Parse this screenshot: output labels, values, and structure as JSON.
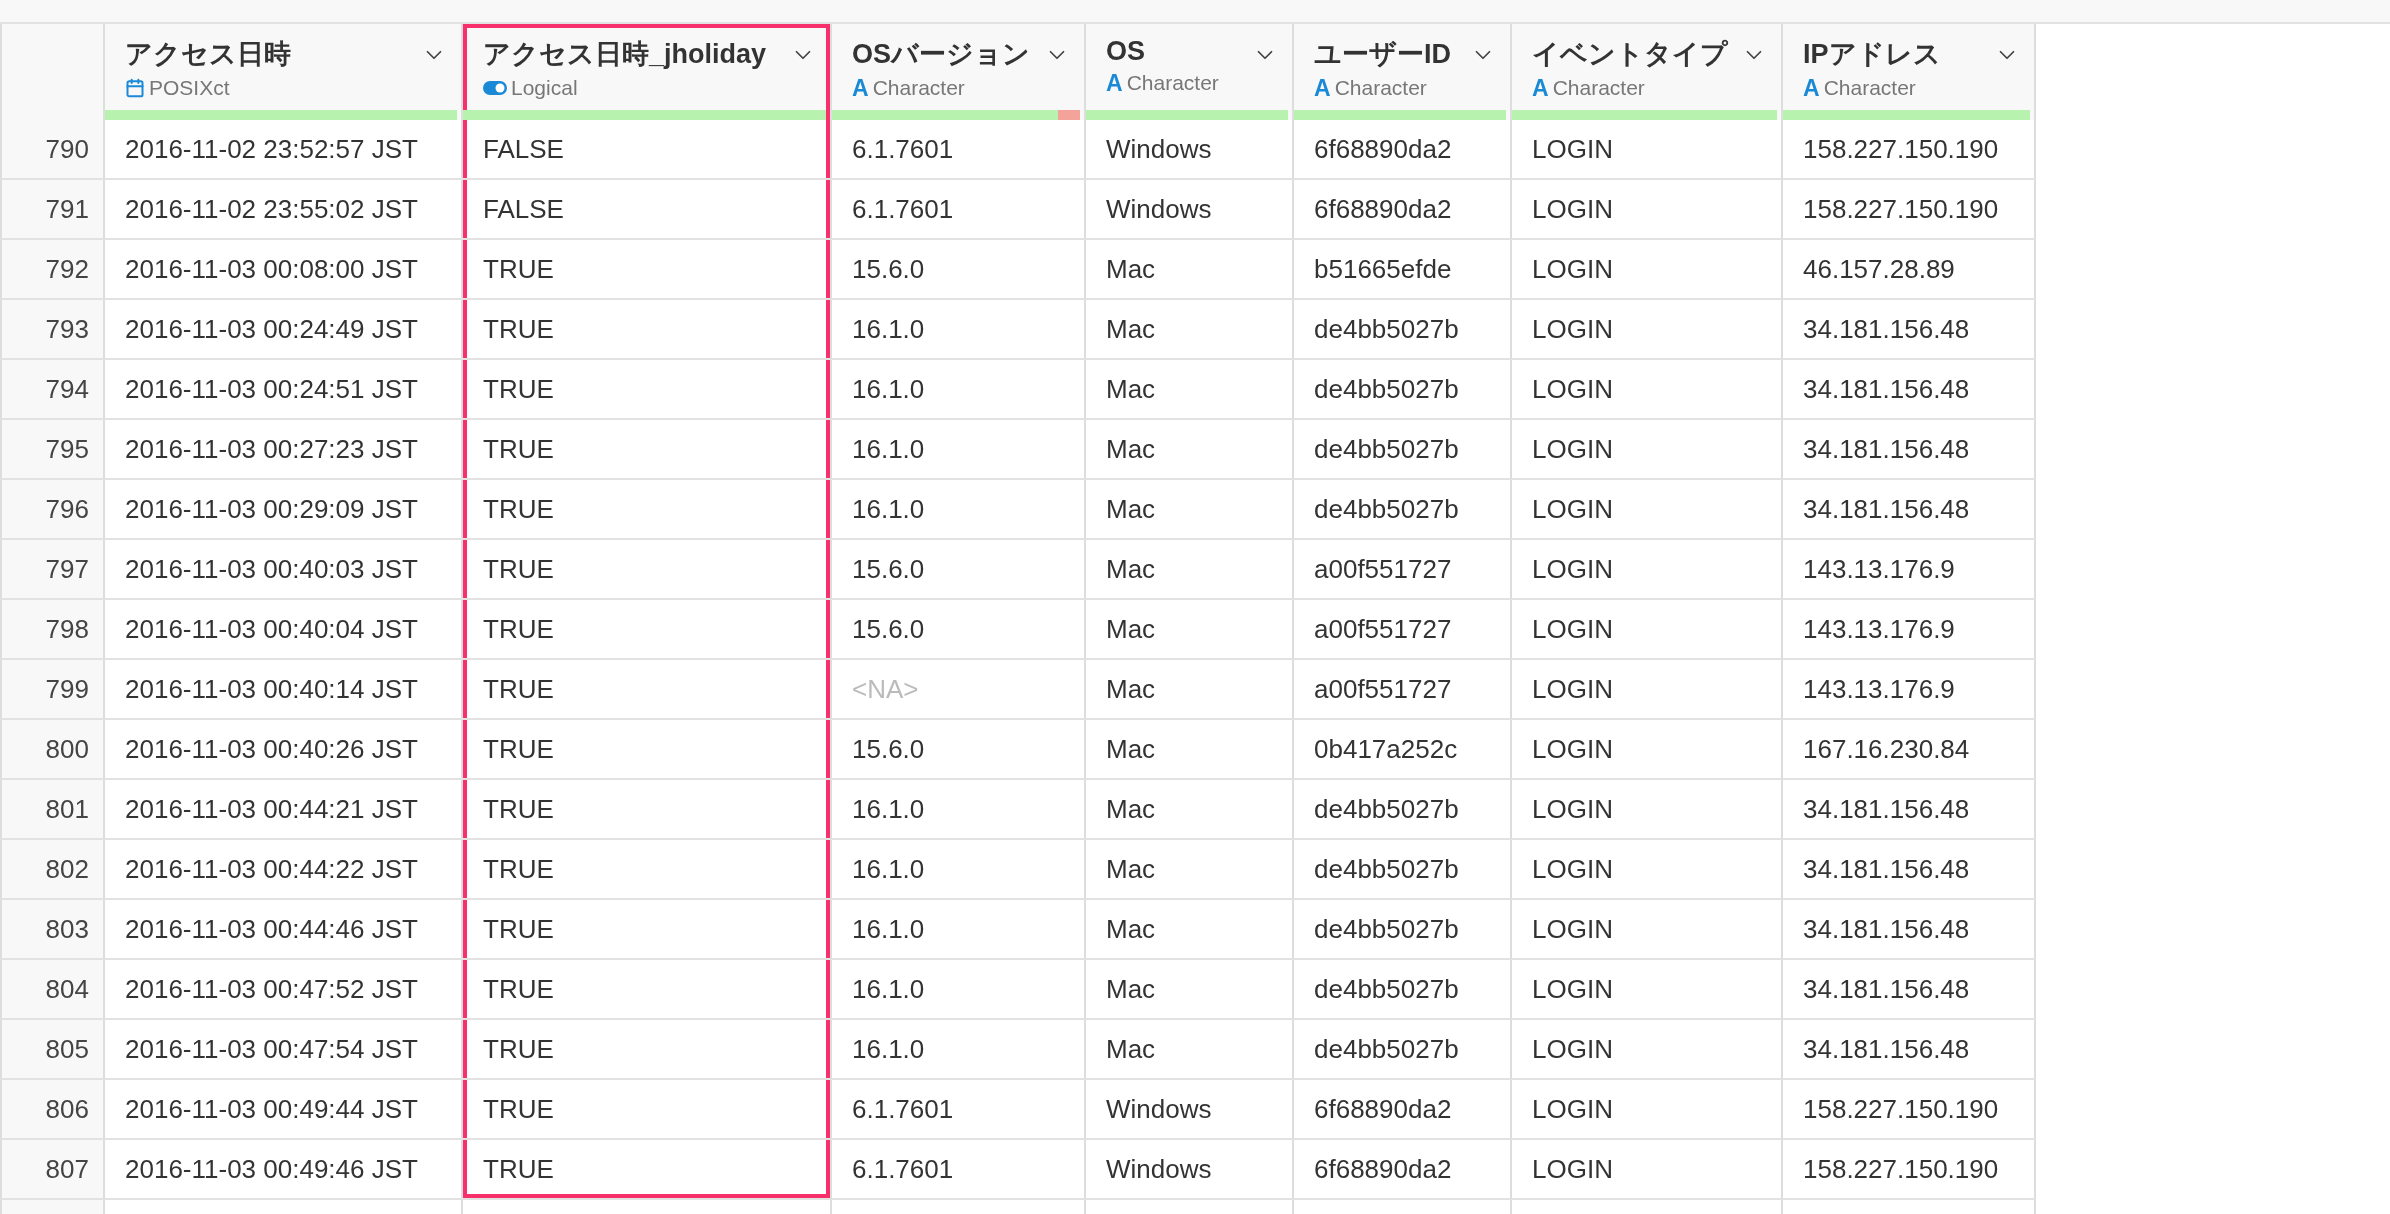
{
  "columns": [
    {
      "title": "アクセス日時",
      "type": {
        "kind": "date",
        "label": "POSIXct"
      },
      "quality": {
        "level": 1
      },
      "highlighted": false
    },
    {
      "title": "アクセス日時_jholiday",
      "type": {
        "kind": "logical",
        "label": "Logical"
      },
      "quality": {
        "level": 1
      },
      "highlighted": true
    },
    {
      "title": "OSバージョン",
      "type": {
        "kind": "character",
        "glyph": "A",
        "label": "Character"
      },
      "quality": {
        "level": 0.91
      },
      "highlighted": false
    },
    {
      "title": "OS",
      "type": {
        "kind": "character",
        "glyph": "A",
        "label": "Character"
      },
      "quality": {
        "level": 1
      },
      "highlighted": false
    },
    {
      "title": "ユーザーID",
      "type": {
        "kind": "character",
        "glyph": "A",
        "label": "Character"
      },
      "quality": {
        "level": 1
      },
      "highlighted": false
    },
    {
      "title": "イベントタイプ",
      "type": {
        "kind": "character",
        "glyph": "A",
        "label": "Character"
      },
      "quality": {
        "level": 1
      },
      "highlighted": false
    },
    {
      "title": "IPアドレス",
      "type": {
        "kind": "character",
        "glyph": "A",
        "label": "Character"
      },
      "quality": {
        "level": 1
      },
      "highlighted": false
    }
  ],
  "rows": [
    {
      "number": "790",
      "cells": [
        "2016-11-02 23:52:57 JST",
        "FALSE",
        "6.1.7601",
        "Windows",
        "6f68890da2",
        "LOGIN",
        "158.227.150.190"
      ],
      "missing": [
        false,
        false,
        false,
        false,
        false,
        false,
        false
      ]
    },
    {
      "number": "791",
      "cells": [
        "2016-11-02 23:55:02 JST",
        "FALSE",
        "6.1.7601",
        "Windows",
        "6f68890da2",
        "LOGIN",
        "158.227.150.190"
      ],
      "missing": [
        false,
        false,
        false,
        false,
        false,
        false,
        false
      ]
    },
    {
      "number": "792",
      "cells": [
        "2016-11-03 00:08:00 JST",
        "TRUE",
        "15.6.0",
        "Mac",
        "b51665efde",
        "LOGIN",
        "46.157.28.89"
      ],
      "missing": [
        false,
        false,
        false,
        false,
        false,
        false,
        false
      ]
    },
    {
      "number": "793",
      "cells": [
        "2016-11-03 00:24:49 JST",
        "TRUE",
        "16.1.0",
        "Mac",
        "de4bb5027b",
        "LOGIN",
        "34.181.156.48"
      ],
      "missing": [
        false,
        false,
        false,
        false,
        false,
        false,
        false
      ]
    },
    {
      "number": "794",
      "cells": [
        "2016-11-03 00:24:51 JST",
        "TRUE",
        "16.1.0",
        "Mac",
        "de4bb5027b",
        "LOGIN",
        "34.181.156.48"
      ],
      "missing": [
        false,
        false,
        false,
        false,
        false,
        false,
        false
      ]
    },
    {
      "number": "795",
      "cells": [
        "2016-11-03 00:27:23 JST",
        "TRUE",
        "16.1.0",
        "Mac",
        "de4bb5027b",
        "LOGIN",
        "34.181.156.48"
      ],
      "missing": [
        false,
        false,
        false,
        false,
        false,
        false,
        false
      ]
    },
    {
      "number": "796",
      "cells": [
        "2016-11-03 00:29:09 JST",
        "TRUE",
        "16.1.0",
        "Mac",
        "de4bb5027b",
        "LOGIN",
        "34.181.156.48"
      ],
      "missing": [
        false,
        false,
        false,
        false,
        false,
        false,
        false
      ]
    },
    {
      "number": "797",
      "cells": [
        "2016-11-03 00:40:03 JST",
        "TRUE",
        "15.6.0",
        "Mac",
        "a00f551727",
        "LOGIN",
        "143.13.176.9"
      ],
      "missing": [
        false,
        false,
        false,
        false,
        false,
        false,
        false
      ]
    },
    {
      "number": "798",
      "cells": [
        "2016-11-03 00:40:04 JST",
        "TRUE",
        "15.6.0",
        "Mac",
        "a00f551727",
        "LOGIN",
        "143.13.176.9"
      ],
      "missing": [
        false,
        false,
        false,
        false,
        false,
        false,
        false
      ]
    },
    {
      "number": "799",
      "cells": [
        "2016-11-03 00:40:14 JST",
        "TRUE",
        "<NA>",
        "Mac",
        "a00f551727",
        "LOGIN",
        "143.13.176.9"
      ],
      "missing": [
        false,
        false,
        true,
        false,
        false,
        false,
        false
      ]
    },
    {
      "number": "800",
      "cells": [
        "2016-11-03 00:40:26 JST",
        "TRUE",
        "15.6.0",
        "Mac",
        "0b417a252c",
        "LOGIN",
        "167.16.230.84"
      ],
      "missing": [
        false,
        false,
        false,
        false,
        false,
        false,
        false
      ]
    },
    {
      "number": "801",
      "cells": [
        "2016-11-03 00:44:21 JST",
        "TRUE",
        "16.1.0",
        "Mac",
        "de4bb5027b",
        "LOGIN",
        "34.181.156.48"
      ],
      "missing": [
        false,
        false,
        false,
        false,
        false,
        false,
        false
      ]
    },
    {
      "number": "802",
      "cells": [
        "2016-11-03 00:44:22 JST",
        "TRUE",
        "16.1.0",
        "Mac",
        "de4bb5027b",
        "LOGIN",
        "34.181.156.48"
      ],
      "missing": [
        false,
        false,
        false,
        false,
        false,
        false,
        false
      ]
    },
    {
      "number": "803",
      "cells": [
        "2016-11-03 00:44:46 JST",
        "TRUE",
        "16.1.0",
        "Mac",
        "de4bb5027b",
        "LOGIN",
        "34.181.156.48"
      ],
      "missing": [
        false,
        false,
        false,
        false,
        false,
        false,
        false
      ]
    },
    {
      "number": "804",
      "cells": [
        "2016-11-03 00:47:52 JST",
        "TRUE",
        "16.1.0",
        "Mac",
        "de4bb5027b",
        "LOGIN",
        "34.181.156.48"
      ],
      "missing": [
        false,
        false,
        false,
        false,
        false,
        false,
        false
      ]
    },
    {
      "number": "805",
      "cells": [
        "2016-11-03 00:47:54 JST",
        "TRUE",
        "16.1.0",
        "Mac",
        "de4bb5027b",
        "LOGIN",
        "34.181.156.48"
      ],
      "missing": [
        false,
        false,
        false,
        false,
        false,
        false,
        false
      ]
    },
    {
      "number": "806",
      "cells": [
        "2016-11-03 00:49:44 JST",
        "TRUE",
        "6.1.7601",
        "Windows",
        "6f68890da2",
        "LOGIN",
        "158.227.150.190"
      ],
      "missing": [
        false,
        false,
        false,
        false,
        false,
        false,
        false
      ]
    },
    {
      "number": "807",
      "cells": [
        "2016-11-03 00:49:46 JST",
        "TRUE",
        "6.1.7601",
        "Windows",
        "6f68890da2",
        "LOGIN",
        "158.227.150.190"
      ],
      "missing": [
        false,
        false,
        false,
        false,
        false,
        false,
        false
      ]
    }
  ]
}
